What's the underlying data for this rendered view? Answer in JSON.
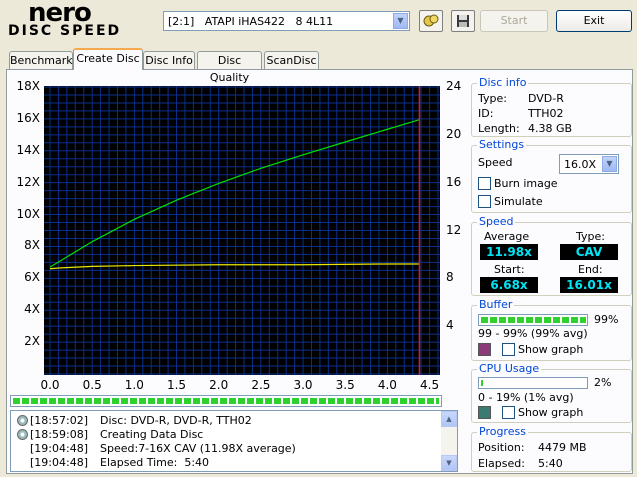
{
  "app": {
    "logo_top": "nero",
    "logo_bottom": "DISC SPEED"
  },
  "toolbar": {
    "drive": "[2:1]   ATAPI iHAS422   8 4L11",
    "start_label": "Start",
    "exit_label": "Exit",
    "icons": [
      "drive-info-icon",
      "save-icon"
    ]
  },
  "tabs": [
    {
      "label": "Benchmark",
      "active": false
    },
    {
      "label": "Create Disc",
      "active": true
    },
    {
      "label": "Disc Info",
      "active": false
    },
    {
      "label": "Disc Quality",
      "active": false
    },
    {
      "label": "ScanDisc",
      "active": false
    }
  ],
  "chart_data": {
    "type": "line",
    "x_ticks": [
      "0.0",
      "0.5",
      "1.0",
      "1.5",
      "2.0",
      "2.5",
      "3.0",
      "3.5",
      "4.0",
      "4.5"
    ],
    "y_left_ticks": [
      "18X",
      "16X",
      "14X",
      "12X",
      "10X",
      "8X",
      "6X",
      "4X",
      "2X"
    ],
    "y_right_ticks": [
      "24",
      "20",
      "16",
      "12",
      "8",
      "4"
    ],
    "xlim": [
      0,
      4.6
    ],
    "ylim_left": [
      0,
      18
    ],
    "ylim_right": [
      0,
      24
    ],
    "end_marker_x": 4.38,
    "grid": true,
    "series": [
      {
        "color": "#00e000",
        "x": [
          0.0,
          0.25,
          0.5,
          1.0,
          1.5,
          2.0,
          2.5,
          3.0,
          3.5,
          4.0,
          4.38
        ],
        "y": [
          6.7,
          7.5,
          8.3,
          9.7,
          10.9,
          11.95,
          12.9,
          13.75,
          14.55,
          15.35,
          15.95
        ]
      },
      {
        "color": "#e8e800",
        "x": [
          0.0,
          0.1,
          0.5,
          1.0,
          2.0,
          3.0,
          4.0,
          4.38
        ],
        "y": [
          6.6,
          6.65,
          6.75,
          6.8,
          6.85,
          6.85,
          6.9,
          6.9
        ]
      }
    ]
  },
  "log": [
    {
      "time": "[18:57:02]",
      "text": "Disc: DVD-R, DVD-R, TTH02"
    },
    {
      "time": "[18:59:08]",
      "text": "Creating Data Disc"
    },
    {
      "time": "[19:04:48]",
      "text": "Speed:7-16X CAV (11.98X average)"
    },
    {
      "time": "[19:04:48]",
      "text": "Elapsed Time:  5:40"
    }
  ],
  "disc_info": {
    "title": "Disc info",
    "type_label": "Type:",
    "type_value": "DVD-R",
    "id_label": "ID:",
    "id_value": "TTH02",
    "length_label": "Length:",
    "length_value": "4.38 GB"
  },
  "settings": {
    "title": "Settings",
    "speed_label": "Speed",
    "speed_value": "16.0X",
    "burn_image_label": "Burn image",
    "simulate_label": "Simulate"
  },
  "speed": {
    "title": "Speed",
    "average_label": "Average",
    "average_value": "11.98x",
    "type_label": "Type:",
    "type_value": "CAV",
    "start_label": "Start:",
    "start_value": "6.68x",
    "end_label": "End:",
    "end_value": "16.01x"
  },
  "buffer": {
    "title": "Buffer",
    "percent": "99%",
    "level": 0.99,
    "range": "99 - 99% (99% avg)",
    "show_graph_label": "Show graph",
    "color": "#8b3a7a"
  },
  "cpu": {
    "title": "CPU Usage",
    "percent": "2%",
    "level": 0.02,
    "range": "0 - 19% (1% avg)",
    "show_graph_label": "Show graph",
    "color": "#3a7a70"
  },
  "progress": {
    "title": "Progress",
    "position_label": "Position:",
    "position_value": "4479 MB",
    "elapsed_label": "Elapsed:",
    "elapsed_value": "5:40",
    "level": 1.0
  }
}
